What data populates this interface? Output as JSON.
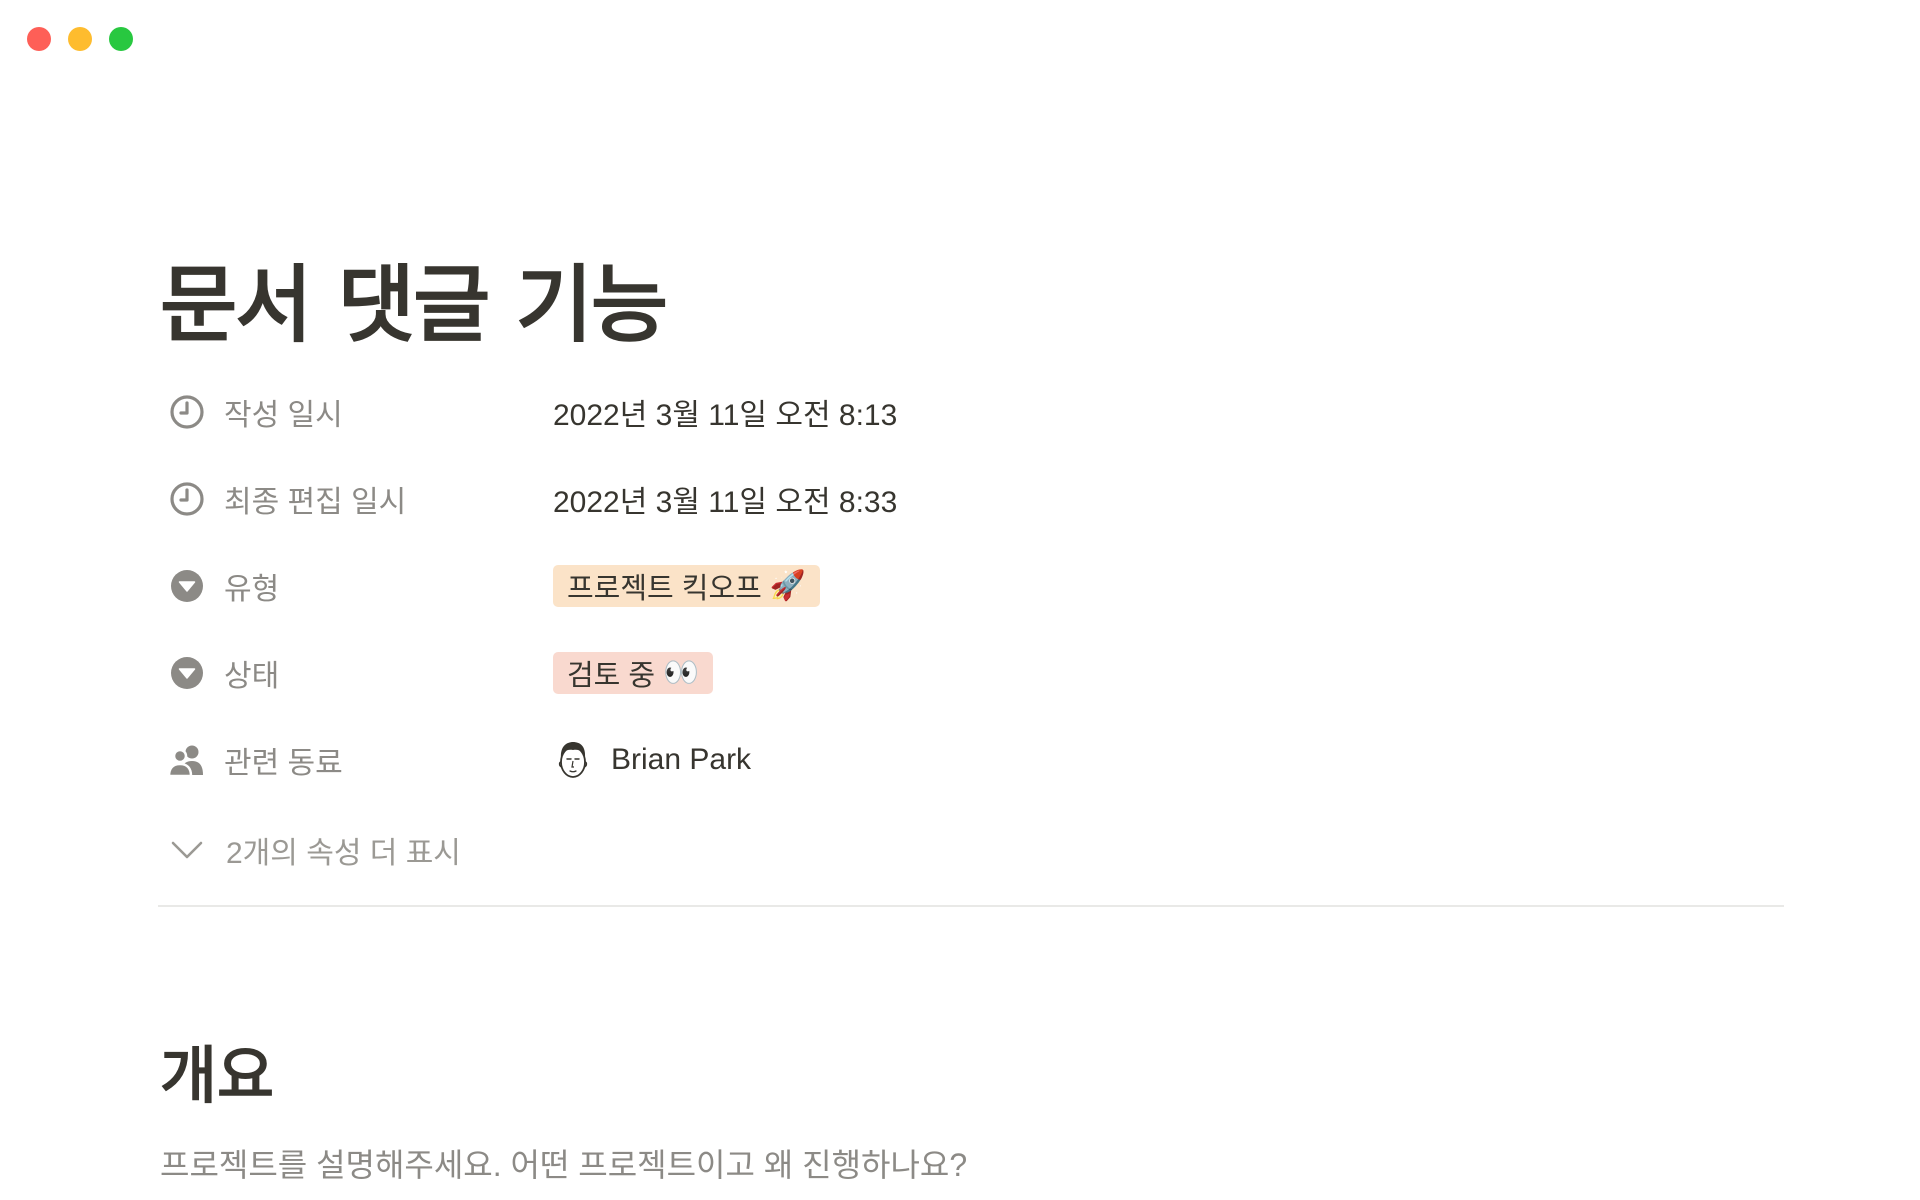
{
  "window": {
    "controls": [
      "close",
      "minimize",
      "maximize"
    ]
  },
  "page": {
    "title": "문서 댓글 기능"
  },
  "properties": [
    {
      "icon": "clock-icon",
      "name": "작성 일시",
      "value": "2022년 3월 11일 오전 8:13"
    },
    {
      "icon": "clock-icon",
      "name": "최종 편집 일시",
      "value": "2022년 3월 11일 오전 8:33"
    },
    {
      "icon": "select-icon",
      "name": "유형",
      "tag": "프로젝트 킥오프",
      "tag_emoji": "🚀",
      "tag_color": "#fbe3c8"
    },
    {
      "icon": "select-icon",
      "name": "상태",
      "tag": "검토 중",
      "tag_emoji": "👀",
      "tag_color": "#f9d9cf"
    },
    {
      "icon": "people-icon",
      "name": "관련 동료",
      "person": "Brian Park"
    }
  ],
  "more_properties": {
    "label": "2개의 속성 더 표시"
  },
  "content": {
    "heading": "개요",
    "paragraph": "프로젝트를 설명해주세요. 어떤 프로젝트이고 왜 진행하나요?"
  },
  "colors": {
    "text": "#37352f",
    "muted": "#8c8a86",
    "divider": "#e9e9e7"
  }
}
